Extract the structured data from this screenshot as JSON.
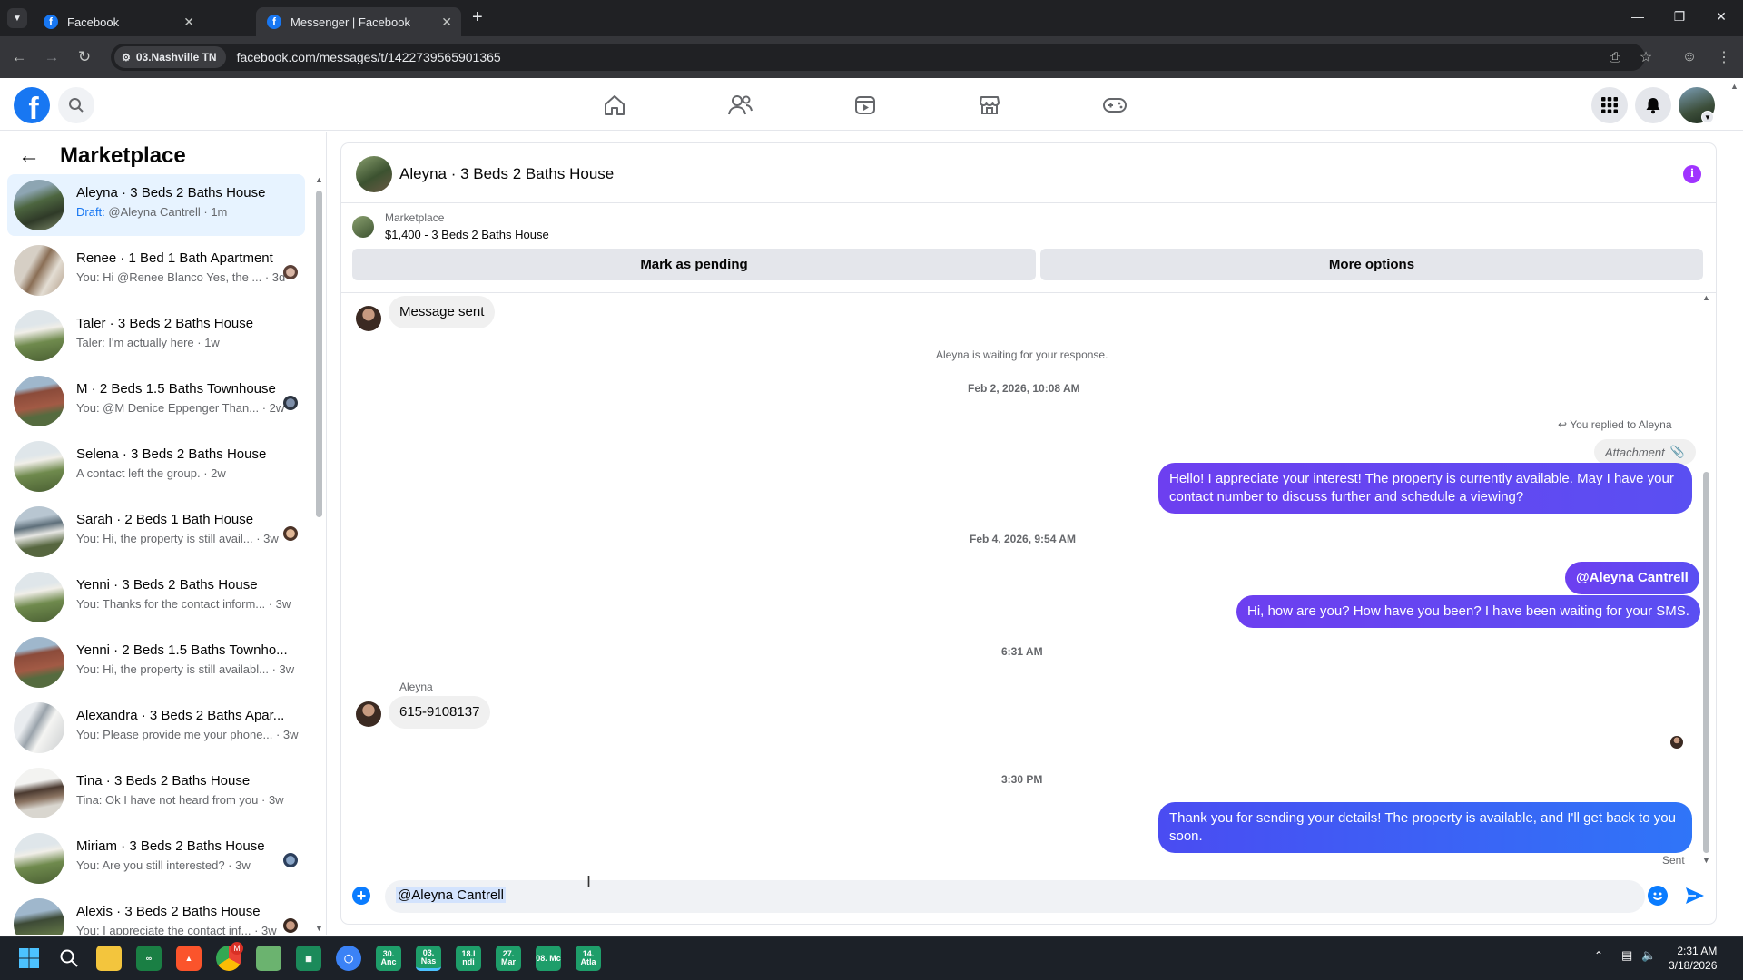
{
  "browser": {
    "tabs": [
      {
        "title": "Facebook",
        "active": false
      },
      {
        "title": "Messenger | Facebook",
        "active": true
      }
    ],
    "site_chip": "03.Nashville TN",
    "url": "facebook.com/messages/t/1422739565901365"
  },
  "colors": {
    "brand": "#1877f2",
    "outgoing_bubble": "#6e3ff3",
    "outgoing_bubble_blue": "#3b6ef7",
    "incoming_bubble": "#f0f0f0",
    "info_purple": "#a033ff"
  },
  "sidebar": {
    "title": "Marketplace",
    "conversations": [
      {
        "name": "Aleyna · 3 Beds 2 Baths House",
        "draft_label": "Draft:",
        "preview": "@Aleyna Cantrell · 1m",
        "selected": true
      },
      {
        "name": "Renee · 1 Bed 1 Bath Apartment",
        "preview": "You: Hi @Renee Blanco Yes, the ... · 3d"
      },
      {
        "name": "Taler · 3 Beds 2 Baths House",
        "preview": "Taler: I'm actually here · 1w"
      },
      {
        "name": "M · 2 Beds 1.5 Baths Townhouse",
        "preview": "You: @M Denice Eppenger Than... · 2w"
      },
      {
        "name": "Selena · 3 Beds 2 Baths House",
        "preview": "A contact left the group. · 2w"
      },
      {
        "name": "Sarah · 2 Beds 1 Bath House",
        "preview": "You: Hi, the property is still avail... · 3w"
      },
      {
        "name": "Yenni · 3 Beds 2 Baths House",
        "preview": "You: Thanks for the contact inform... · 3w"
      },
      {
        "name": "Yenni · 2 Beds 1.5 Baths Townho...",
        "preview": "You: Hi, the property is still availabl... · 3w"
      },
      {
        "name": "Alexandra · 3 Beds 2 Baths Apar...",
        "preview": "You: Please provide me your phone... · 3w"
      },
      {
        "name": "Tina · 3 Beds 2 Baths House",
        "preview": "Tina: Ok I have not heard from you · 3w"
      },
      {
        "name": "Miriam · 3 Beds 2 Baths House",
        "preview": "You: Are you still interested? · 3w"
      },
      {
        "name": "Alexis · 3 Beds 2 Baths House",
        "preview": "You: I appreciate the contact inf... · 3w"
      }
    ]
  },
  "chat": {
    "title": "Aleyna · 3 Beds 2 Baths House",
    "listing_source": "Marketplace",
    "listing_price": "$1,400 - 3 Beds 2 Baths House",
    "mark_pending": "Mark as pending",
    "more_options": "More options",
    "messages": {
      "msg_sent": "Message sent",
      "waiting": "Aleyna is waiting for your response.",
      "ts1": "Feb 2, 2026, 10:08 AM",
      "replied": "You replied to Aleyna",
      "attachment": "Attachment",
      "out1": "Hello! I appreciate your interest! The property is currently available. May I have your contact number to discuss further and schedule a viewing?",
      "ts2": "Feb 4, 2026, 9:54 AM",
      "mention": "@Aleyna Cantrell",
      "out2": "Hi, how are you? How have you been? I have been waiting for your SMS.",
      "ts3": "6:31 AM",
      "sender": "Aleyna",
      "in_phone": "615-9108137",
      "ts4": "3:30 PM",
      "out3": "Thank you for sending your details! The property is available, and I'll get back to you soon.",
      "sent_status": "Sent"
    },
    "composer_value": "@Aleyna Cantrell"
  },
  "taskbar": {
    "apps": [
      "30. Anc",
      "03. Nas",
      "18.I ndi",
      "27. Mar",
      "08. Mc",
      "14. Atla"
    ],
    "time": "2:31 AM",
    "date": "3/18/2026",
    "chrome_badge": "M"
  }
}
